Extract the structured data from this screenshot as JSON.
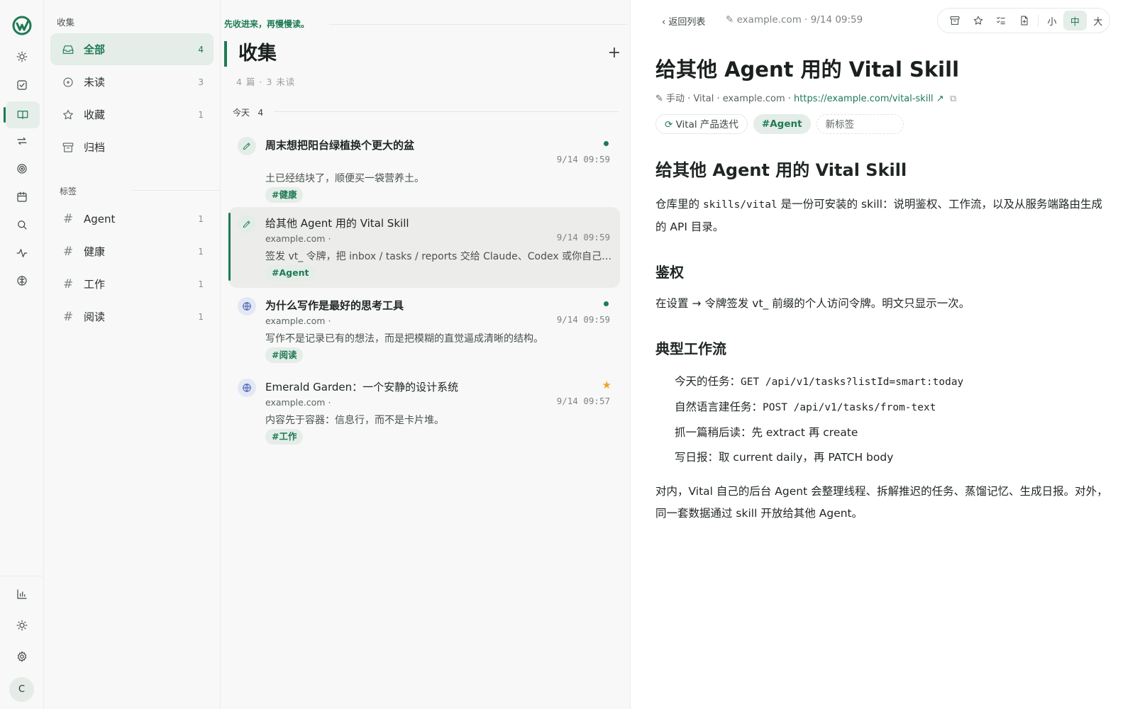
{
  "nav": {
    "heading": "收集",
    "items": [
      {
        "label": "全部",
        "count": "4",
        "icon": "inbox-icon"
      },
      {
        "label": "未读",
        "count": "3",
        "icon": "circle-dot-icon"
      },
      {
        "label": "收藏",
        "count": "1",
        "icon": "star-icon"
      },
      {
        "label": "归档",
        "count": "",
        "icon": "archive-icon"
      }
    ],
    "tags_heading": "标签",
    "tags": [
      {
        "label": "Agent",
        "count": "1"
      },
      {
        "label": "健康",
        "count": "1"
      },
      {
        "label": "工作",
        "count": "1"
      },
      {
        "label": "阅读",
        "count": "1"
      }
    ]
  },
  "rail": {
    "avatar": "C",
    "icons": [
      "logo-icon",
      "sun-icon",
      "checkbox-icon",
      "book-icon",
      "repeat-icon",
      "target-icon",
      "calendar-icon",
      "search-icon",
      "activity-icon",
      "brain-icon",
      "chart-icon",
      "theme-icon",
      "settings-icon"
    ]
  },
  "list": {
    "slogan": "先收进来，再慢慢读。",
    "title": "收集",
    "add": "+",
    "stats": "4 篇 · 3 未读",
    "group_label": "今天",
    "group_count": "4",
    "items": [
      {
        "title": "周末想把阳台绿植换个更大的盆",
        "domain": "",
        "time": "9/14 09:59",
        "excerpt": "土已经结块了，顺便买一袋营养土。",
        "tag": "#健康",
        "unread": true,
        "starred": false,
        "type": "note"
      },
      {
        "title": "给其他 Agent 用的 Vital Skill",
        "domain": "example.com ·",
        "time": "9/14 09:59",
        "excerpt": "签发 vt_ 令牌，把 inbox / tasks / reports 交给 Claude、Codex 或你自己的 Agent",
        "tag": "#Agent",
        "unread": false,
        "starred": false,
        "type": "note"
      },
      {
        "title": "为什么写作是最好的思考工具",
        "domain": "example.com ·",
        "time": "9/14 09:59",
        "excerpt": "写作不是记录已有的想法，而是把模糊的直觉逼成清晰的结构。",
        "tag": "#阅读",
        "unread": true,
        "starred": false,
        "type": "web"
      },
      {
        "title": "Emerald Garden：一个安静的设计系统",
        "domain": "example.com ·",
        "time": "9/14 09:57",
        "excerpt": "内容先于容器：信息行，而不是卡片堆。",
        "tag": "#工作",
        "unread": false,
        "starred": true,
        "type": "web"
      }
    ]
  },
  "reader": {
    "back": "返回列表",
    "meta_top": "example.com · 9/14 09:59",
    "toolbar": {
      "size_small": "小",
      "size_medium": "中",
      "size_large": "大",
      "selected_size": "中"
    },
    "title": "给其他 Agent 用的 Vital Skill",
    "meta": {
      "source": "手动",
      "app": "Vital",
      "domain": "example.com",
      "url": "https://example.com/vital-skill"
    },
    "chips": {
      "project": "Vital 产品迭代",
      "tag": "#Agent",
      "new_tag_placeholder": "新标签"
    },
    "body": {
      "h2": "给其他 Agent 用的 Vital Skill",
      "p1_a": "仓库里的 ",
      "p1_code": "skills/vital",
      "p1_b": " 是一份可安装的 skill：说明鉴权、工作流，以及从服务端路由生成的 API 目录。",
      "h3_auth": "鉴权",
      "p2": "在设置 → 令牌签发 vt_ 前缀的个人访问令牌。明文只显示一次。",
      "h3_flow": "典型工作流",
      "flow": [
        {
          "label": "今天的任务：",
          "code": "GET /api/v1/tasks?listId=smart:today"
        },
        {
          "label": "自然语言建任务：",
          "code": "POST /api/v1/tasks/from-text"
        },
        {
          "label": "抓一篇稍后读：先 extract 再 create",
          "code": ""
        },
        {
          "label": "写日报：取 current daily，再 PATCH body",
          "code": ""
        }
      ],
      "closing": "对内，Vital 自己的后台 Agent 会整理线程、拆解推迟的任务、蒸馏记忆、生成日报。对外，同一套数据通过 skill 开放给其他 Agent。"
    }
  },
  "colors": {
    "accent": "#1f7a55",
    "star": "#e8a72a",
    "web_icon": "#3b56b0"
  }
}
